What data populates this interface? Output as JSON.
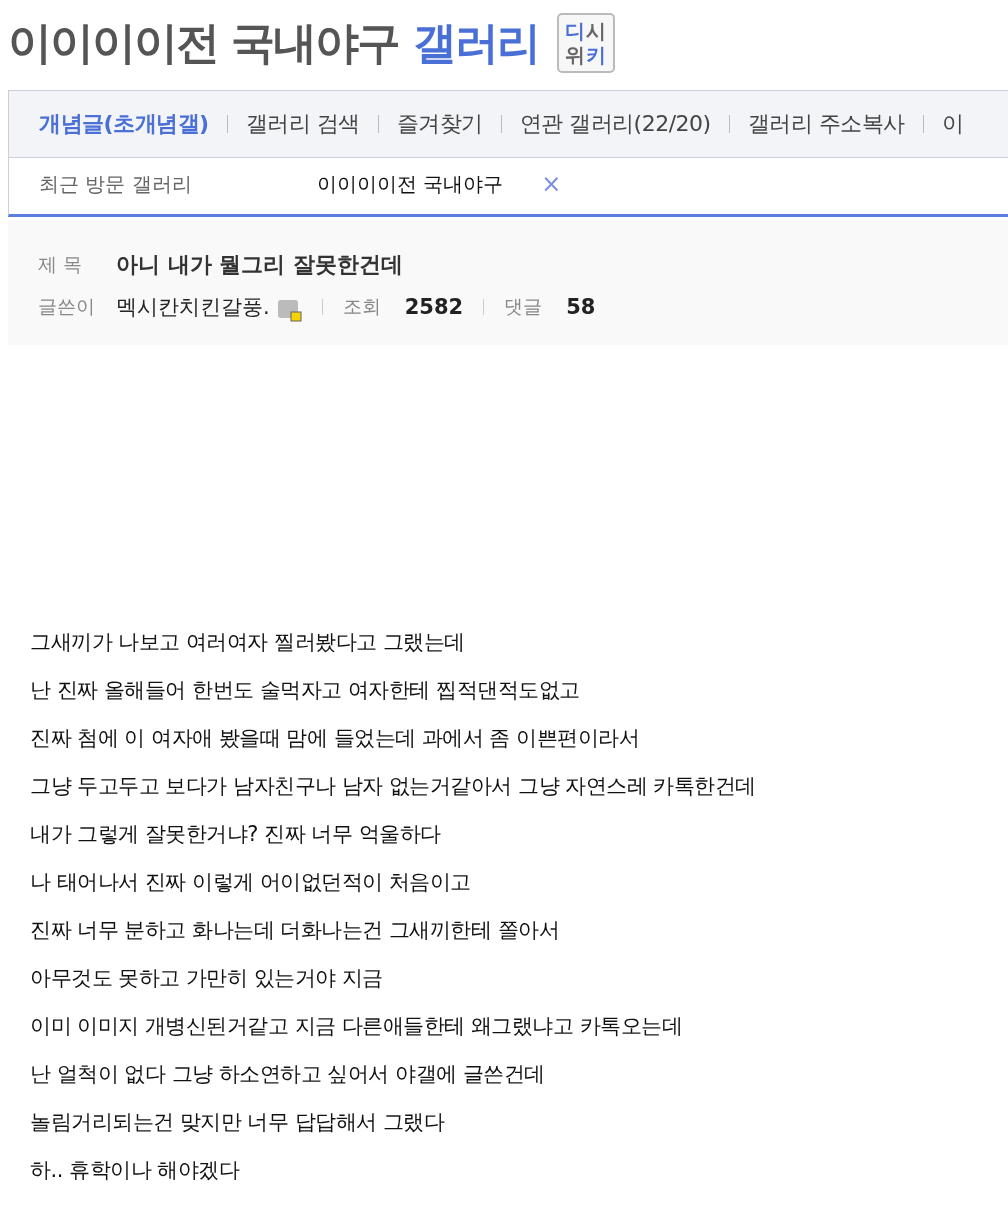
{
  "header": {
    "title": "이이이이전 국내야구",
    "title_suffix": "갤러리",
    "logo": [
      {
        "text": "디",
        "color": "#4a6fd6"
      },
      {
        "text": "시",
        "color": "#666666"
      },
      {
        "text": "위",
        "color": "#666666"
      },
      {
        "text": "키",
        "color": "#4a6fd6"
      }
    ]
  },
  "nav": [
    {
      "label": "개념글(초개념갤)",
      "selected": true
    },
    {
      "label": "갤러리 검색",
      "selected": false
    },
    {
      "label": "즐겨찾기",
      "selected": false
    },
    {
      "label": "연관 갤러리(22/20)",
      "selected": false
    },
    {
      "label": "갤러리 주소복사",
      "selected": false
    },
    {
      "label": "이",
      "selected": false
    }
  ],
  "recent": {
    "label": "최근 방문 갤러리",
    "items": [
      {
        "name": "이이이이전 국내야구",
        "close": "×"
      }
    ]
  },
  "post": {
    "title_label": "제 목",
    "title": "아니 내가 뭘그리 잘못한건데",
    "author_label": "글쓴이",
    "author": "멕시칸치킨갈풍.",
    "views_label": "조회",
    "views": "2582",
    "comments_label": "댓글",
    "comments": "58"
  },
  "body": [
    "그새끼가 나보고 여러여자 찔러봤다고 그랬는데",
    "난 진짜 올해들어 한번도 술먹자고 여자한테 찝적댄적도없고",
    "진짜 첨에 이 여자애 봤을때 맘에 들었는데 과에서 좀 이쁜편이라서",
    "그냥 두고두고 보다가 남자친구나 남자 없는거같아서 그냥 자연스레 카톡한건데",
    "내가 그렇게 잘못한거냐? 진짜 너무 억울하다",
    "나 태어나서 진짜 이렇게 어이없던적이 처음이고",
    "진짜 너무 분하고 화나는데 더화나는건 그새끼한테 쫄아서",
    "아무것도 못하고 가만히 있는거야 지금",
    "이미 이미지 개병신된거같고 지금 다른애들한테 왜그랬냐고 카톡오는데",
    "난 얼척이 없다 그냥 하소연하고 싶어서 야갤에 글쓴건데",
    "놀림거리되는건 맞지만 너무 답답해서 그랬다",
    "하.. 휴학이나 해야겠다"
  ]
}
